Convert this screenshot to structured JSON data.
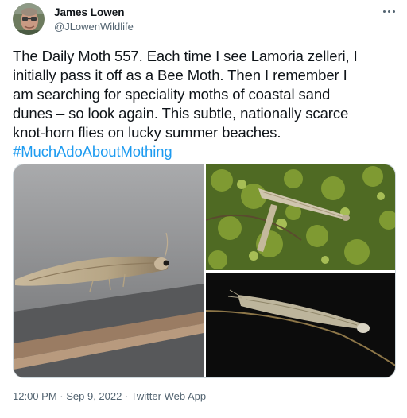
{
  "author": {
    "name": "James Lowen",
    "handle": "@JLowenWildlife",
    "avatar_icon": "profile-photo"
  },
  "more_icon": "more-horizontal-icon",
  "tweet": {
    "lines": [
      "The Daily Moth 557. Each time I see Lamoria zelleri, I",
      "initially pass it off as a Bee Moth. Then I remember I",
      "am searching for speciality moths of coastal sand",
      "dunes – so look again. This subtle, nationally scarce",
      "knot-horn flies on lucky summer beaches."
    ],
    "hashtag": "#MuchAdoAboutMothing"
  },
  "media": [
    {
      "description_icon": "moth-photo-grey-background"
    },
    {
      "description_icon": "moth-photo-on-moss"
    },
    {
      "description_icon": "moth-photo-on-grass-stem"
    }
  ],
  "meta": {
    "time": "12:00 PM",
    "separator": " · ",
    "date": "Sep 9, 2022",
    "source": "Twitter Web App"
  },
  "colors": {
    "text": "#0f1419",
    "secondary": "#536471",
    "link": "#1d9bf0",
    "border": "#cfd9de"
  }
}
